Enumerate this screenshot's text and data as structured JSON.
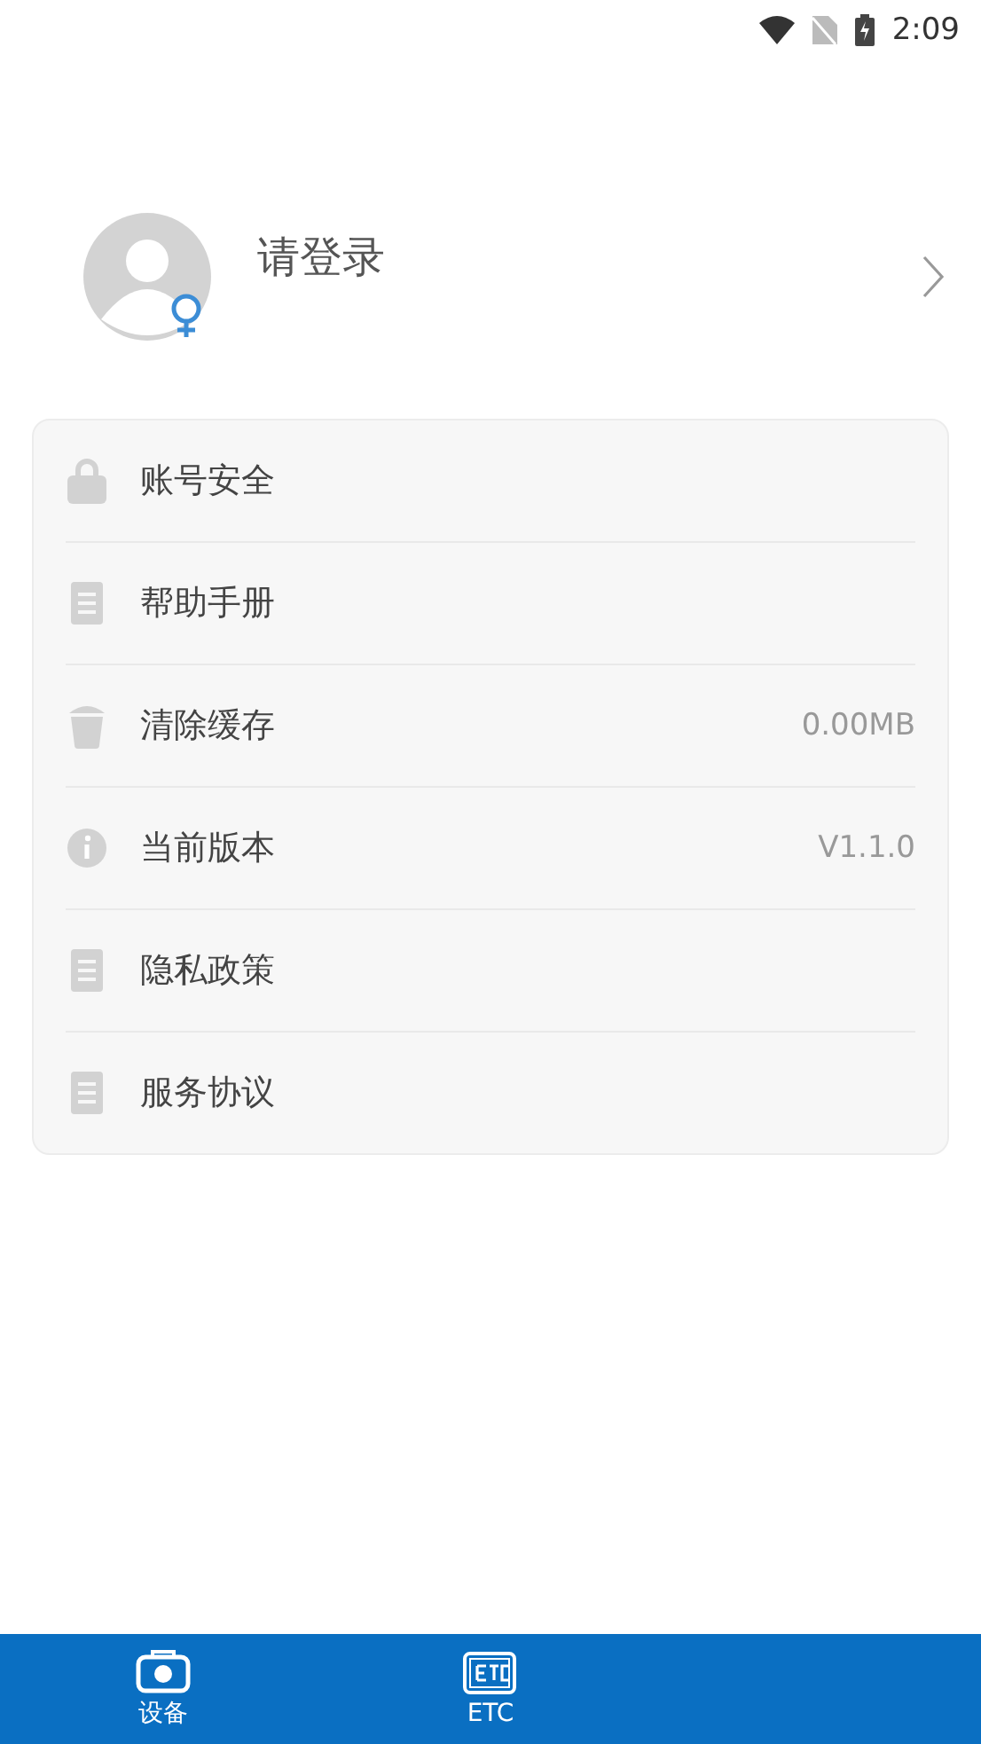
{
  "status_bar": {
    "time": "2:09"
  },
  "profile": {
    "name": "请登录"
  },
  "settings": [
    {
      "kind": "lock",
      "label": "账号安全"
    },
    {
      "kind": "document",
      "label": "帮助手册"
    },
    {
      "kind": "trash",
      "label": "清除缓存",
      "value": "0.00MB"
    },
    {
      "kind": "info",
      "label": "当前版本",
      "value": "V1.1.0"
    },
    {
      "kind": "document",
      "label": "隐私政策"
    },
    {
      "kind": "document",
      "label": "服务协议"
    }
  ],
  "bottom_nav": [
    {
      "kind": "camera",
      "label": "设备"
    },
    {
      "kind": "etc",
      "label": "ETC"
    }
  ]
}
